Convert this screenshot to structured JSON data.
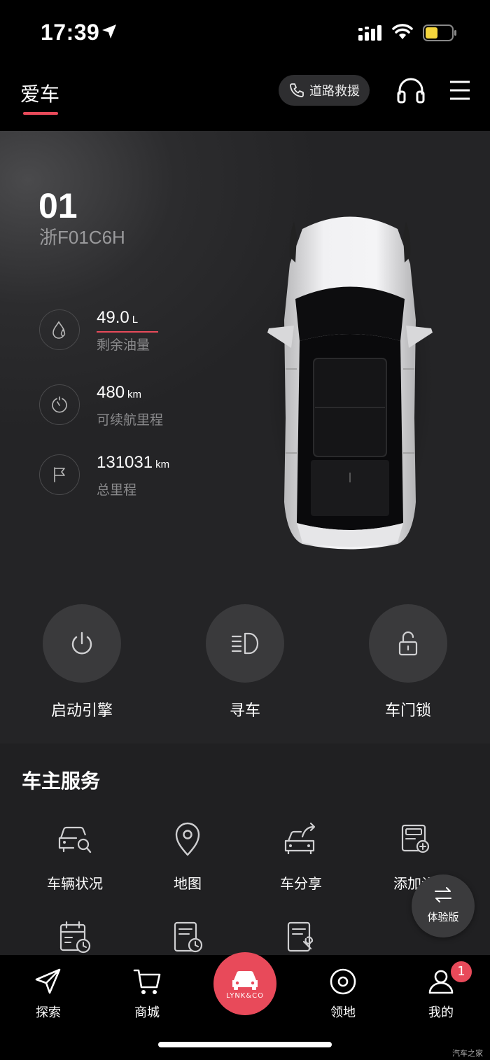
{
  "status_bar": {
    "time": "17:39"
  },
  "header": {
    "active_tab": "爱车",
    "rescue_label": "道路救援"
  },
  "vehicle": {
    "model": "01",
    "plate": "浙F01C6H",
    "stats": [
      {
        "value": "49.0",
        "unit": "L",
        "label": "剩余油量",
        "icon": "fuel-drop-icon"
      },
      {
        "value": "480",
        "unit": "km",
        "label": "可续航里程",
        "icon": "range-gauge-icon"
      },
      {
        "value": "131031",
        "unit": "km",
        "label": "总里程",
        "icon": "flag-icon"
      }
    ]
  },
  "controls": [
    {
      "label": "启动引擎",
      "icon": "power-icon"
    },
    {
      "label": "寻车",
      "icon": "headlight-icon"
    },
    {
      "label": "车门锁",
      "icon": "unlock-icon"
    }
  ],
  "services": {
    "title": "车主服务",
    "items": [
      {
        "label": "车辆状况",
        "icon": "car-search-icon"
      },
      {
        "label": "地图",
        "icon": "map-pin-icon"
      },
      {
        "label": "车分享",
        "icon": "car-share-icon"
      },
      {
        "label": "添加设",
        "icon": "add-device-icon"
      }
    ],
    "second_row_icons": [
      "calendar-clock-icon",
      "document-clock-icon",
      "document-wrench-icon"
    ]
  },
  "trial_button": {
    "label": "体验版"
  },
  "bottom_nav": {
    "items": [
      {
        "label": "探索",
        "icon": "send-icon"
      },
      {
        "label": "商城",
        "icon": "cart-icon"
      },
      {
        "label": "",
        "icon": "lynk-car-icon"
      },
      {
        "label": "领地",
        "icon": "target-icon"
      },
      {
        "label": "我的",
        "icon": "user-icon"
      }
    ],
    "center_logo": "LYNK&CO",
    "badge_count": "1"
  },
  "watermark": "汽车之家",
  "colors": {
    "accent": "#e84a5a",
    "background": "#202022",
    "header": "#000000"
  }
}
